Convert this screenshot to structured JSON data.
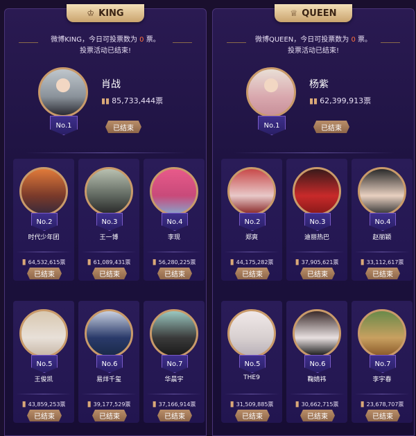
{
  "king": {
    "title": "KING",
    "notice_prefix": "微博KING，今日可投票数为 ",
    "notice_count": "0",
    "notice_suffix": " 票。",
    "notice_line2": "投票活动已结束!",
    "top": {
      "rank": "No.1",
      "name": "肖战",
      "votes": "85,733,444票",
      "button": "已结束"
    },
    "cards": [
      {
        "rank": "No.2",
        "name": "时代少年团",
        "votes": "64,532,615票",
        "button": "已结束"
      },
      {
        "rank": "No.3",
        "name": "王一博",
        "votes": "61,089,431票",
        "button": "已结束"
      },
      {
        "rank": "No.4",
        "name": "李现",
        "votes": "56,280,225票",
        "button": "已结束"
      },
      {
        "rank": "No.5",
        "name": "王俊凯",
        "votes": "43,859,253票",
        "button": "已结束"
      },
      {
        "rank": "No.6",
        "name": "易烊千玺",
        "votes": "39,177,529票",
        "button": "已结束"
      },
      {
        "rank": "No.7",
        "name": "华晨宇",
        "votes": "37,166,914票",
        "button": "已结束"
      }
    ]
  },
  "queen": {
    "title": "QUEEN",
    "notice_prefix": "微博QUEEN，今日可投票数为 ",
    "notice_count": "0",
    "notice_suffix": " 票。",
    "notice_line2": "投票活动已结束!",
    "top": {
      "rank": "No.1",
      "name": "杨紫",
      "votes": "62,399,913票",
      "button": "已结束"
    },
    "cards": [
      {
        "rank": "No.2",
        "name": "郑爽",
        "votes": "44,175,282票",
        "button": "已结束"
      },
      {
        "rank": "No.3",
        "name": "迪丽热巴",
        "votes": "37,905,621票",
        "button": "已结束"
      },
      {
        "rank": "No.4",
        "name": "赵丽颖",
        "votes": "33,112,617票",
        "button": "已结束"
      },
      {
        "rank": "No.5",
        "name": "THE9",
        "votes": "31,509,885票",
        "button": "已结束"
      },
      {
        "rank": "No.6",
        "name": "鞠婧祎",
        "votes": "30,662,715票",
        "button": "已结束"
      },
      {
        "rank": "No.7",
        "name": "李宇春",
        "votes": "23,678,707票",
        "button": "已结束"
      }
    ]
  },
  "icons": {
    "crown": "crown-icon",
    "votes": "bar-chart-icon"
  },
  "colors": {
    "accent": "#ff6f3d",
    "gold": "#caa46e",
    "button": "#a57c5b"
  }
}
